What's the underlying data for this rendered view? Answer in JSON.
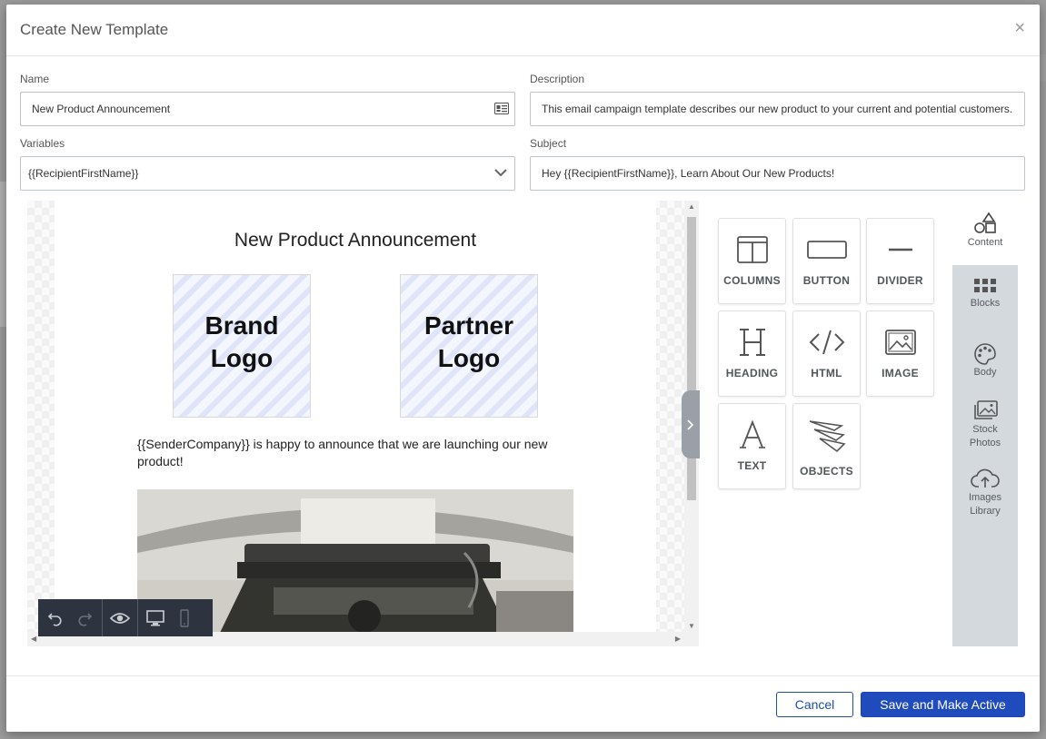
{
  "modal": {
    "title": "Create New Template",
    "close_glyph": "×"
  },
  "form": {
    "name": {
      "label": "Name",
      "value": "New Product Announcement"
    },
    "description": {
      "label": "Description",
      "value": "This email campaign template describes our new product to your current and potential customers."
    },
    "variables": {
      "label": "Variables",
      "value": "{{RecipientFirstName}}"
    },
    "subject": {
      "label": "Subject",
      "value": "Hey {{RecipientFirstName}}, Learn About Our New Products!"
    }
  },
  "email": {
    "title": "New Product Announcement",
    "brand_logo": [
      "Brand",
      "Logo"
    ],
    "partner_logo": [
      "Partner",
      "Logo"
    ],
    "announcement": "{{SenderCompany}} is happy to announce that we are launching our new product!"
  },
  "toolbar": {
    "icons": [
      "undo-icon",
      "redo-icon",
      "preview-eye-icon",
      "desktop-icon",
      "mobile-icon"
    ]
  },
  "tools": [
    {
      "label": "COLUMNS",
      "icon": "columns-icon"
    },
    {
      "label": "BUTTON",
      "icon": "button-icon"
    },
    {
      "label": "DIVIDER",
      "icon": "divider-icon"
    },
    {
      "label": "HEADING",
      "icon": "heading-icon"
    },
    {
      "label": "HTML",
      "icon": "html-icon"
    },
    {
      "label": "IMAGE",
      "icon": "image-icon"
    },
    {
      "label": "TEXT",
      "icon": "text-icon"
    },
    {
      "label": "OBJECTS",
      "icon": "objects-icon"
    }
  ],
  "side_tabs": [
    {
      "label": "Content",
      "icon": "shapes-icon",
      "active": true
    },
    {
      "label": "Blocks",
      "icon": "grid-icon"
    },
    {
      "label": "Body",
      "icon": "palette-icon"
    },
    {
      "label": "Stock\nPhotos",
      "line1": "Stock",
      "line2": "Photos",
      "icon": "photos-icon"
    },
    {
      "label": "Images\nLibrary",
      "line1": "Images",
      "line2": "Library",
      "icon": "cloud-upload-icon"
    }
  ],
  "footer": {
    "cancel_label": "Cancel",
    "save_label": "Save and Make Active"
  },
  "colors": {
    "primary": "#1f4bbd",
    "toolbar_bg": "#2d3440",
    "side_panel_bg": "#d4d9dd"
  }
}
